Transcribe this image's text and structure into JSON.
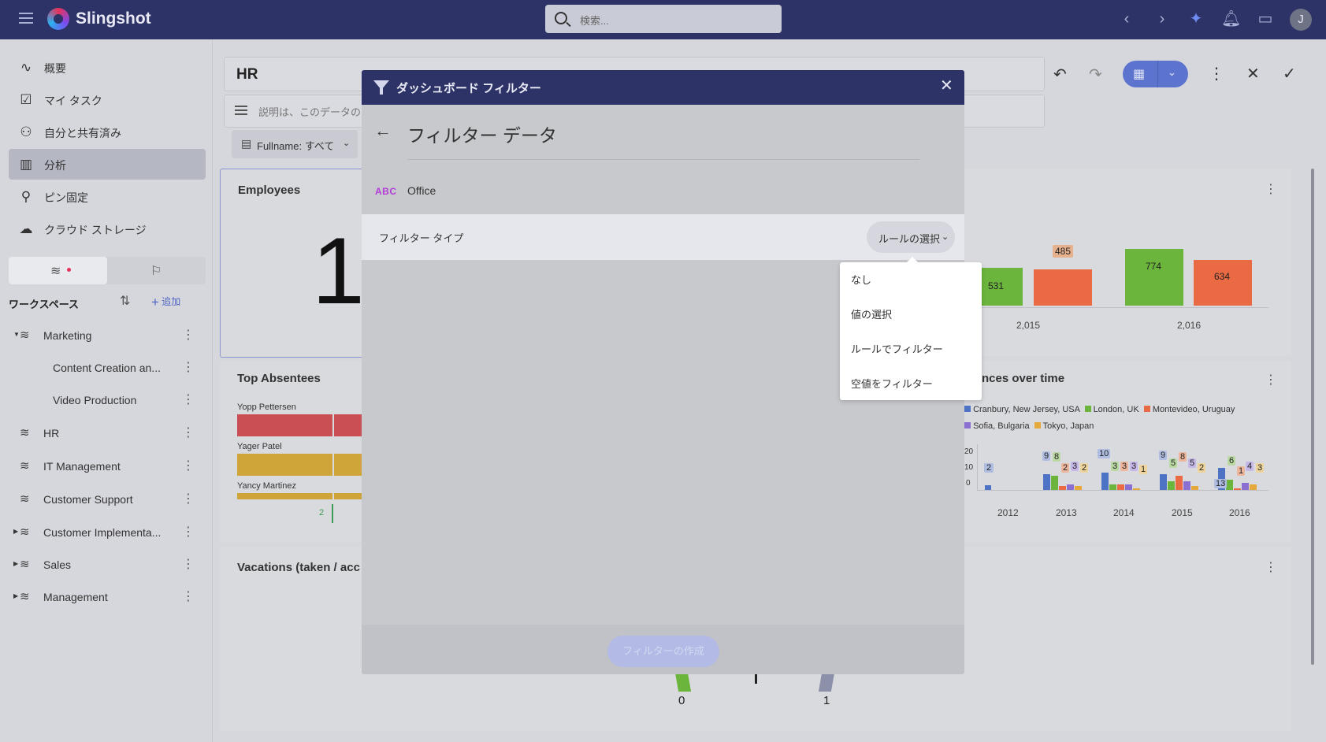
{
  "app": {
    "name": "Slingshot",
    "avatar_initial": "J"
  },
  "search": {
    "placeholder": "検索..."
  },
  "sidebar": {
    "nav": [
      {
        "label": "概要",
        "icon": "activity-icon"
      },
      {
        "label": "マイ タスク",
        "icon": "task-icon"
      },
      {
        "label": "自分と共有済み",
        "icon": "shared-user-icon"
      },
      {
        "label": "分析",
        "icon": "bar-chart-icon"
      },
      {
        "label": "ピン固定",
        "icon": "pin-icon"
      },
      {
        "label": "クラウド ストレージ",
        "icon": "cloud-icon"
      }
    ],
    "workspace_title": "ワークスペース",
    "add_label": "追加",
    "workspaces": [
      {
        "label": "Marketing"
      },
      {
        "label": "Content Creation an..."
      },
      {
        "label": "Video Production"
      },
      {
        "label": "HR"
      },
      {
        "label": "IT Management"
      },
      {
        "label": "Customer Support"
      },
      {
        "label": "Customer Implementa..."
      },
      {
        "label": "Sales"
      },
      {
        "label": "Management"
      }
    ]
  },
  "dashboard": {
    "title": "HR",
    "description_placeholder": "説明は、このデータのコンテキスト",
    "filter_chip": "Fullname: すべて"
  },
  "cards": {
    "employees": {
      "title": "Employees",
      "value": "1"
    },
    "absentees": {
      "title": "Top Absentees",
      "rows": [
        "Yopp Pettersen",
        "Yager Patel",
        "Yancy Martinez"
      ],
      "axis_value": "2"
    },
    "vacations": {
      "title": "Vacations (taken / acc",
      "gauge_min": "0",
      "gauge_max": "1"
    },
    "bar_top": {
      "labels": [
        "531",
        "485",
        "774",
        "634"
      ],
      "x_ticks": [
        "2,015",
        "2,016"
      ]
    },
    "over_time": {
      "title": "nces over time",
      "legend": [
        "Cranbury, New Jersey, USA",
        "London, UK",
        "Montevideo, Uruguay",
        "Sofia, Bulgaria",
        "Tokyo, Japan"
      ],
      "x_ticks": [
        "2012",
        "2013",
        "2014",
        "2015",
        "2016"
      ],
      "y_ticks": [
        "20",
        "10",
        "0"
      ],
      "labels_2012": [
        "2"
      ],
      "labels_2013": [
        "9",
        "8",
        "2",
        "3",
        "2"
      ],
      "labels_2014": [
        "10",
        "3",
        "3",
        "3",
        "1"
      ],
      "labels_2015": [
        "9",
        "5",
        "8",
        "5",
        "2"
      ],
      "labels_2016": [
        "13",
        "6",
        "1",
        "4",
        "3"
      ]
    }
  },
  "modal": {
    "title": "ダッシュボード フィルター",
    "heading": "フィルター データ",
    "field_type_badge": "ABC",
    "field_name": "Office",
    "filter_type_label": "フィルター タイプ",
    "filter_type_value": "ルールの選択",
    "create_button": "フィルターの作成"
  },
  "dropdown": {
    "options": [
      "なし",
      "値の選択",
      "ルールでフィルター",
      "空値をフィルター"
    ]
  },
  "colors": {
    "header": "#2d3366",
    "accent": "#5d74cf",
    "series_green": "#6bb53c",
    "series_orange": "#e96a43",
    "series_blue": "#4e73c4",
    "series_purple": "#8b6fd1",
    "series_yellow": "#e4a93a"
  }
}
